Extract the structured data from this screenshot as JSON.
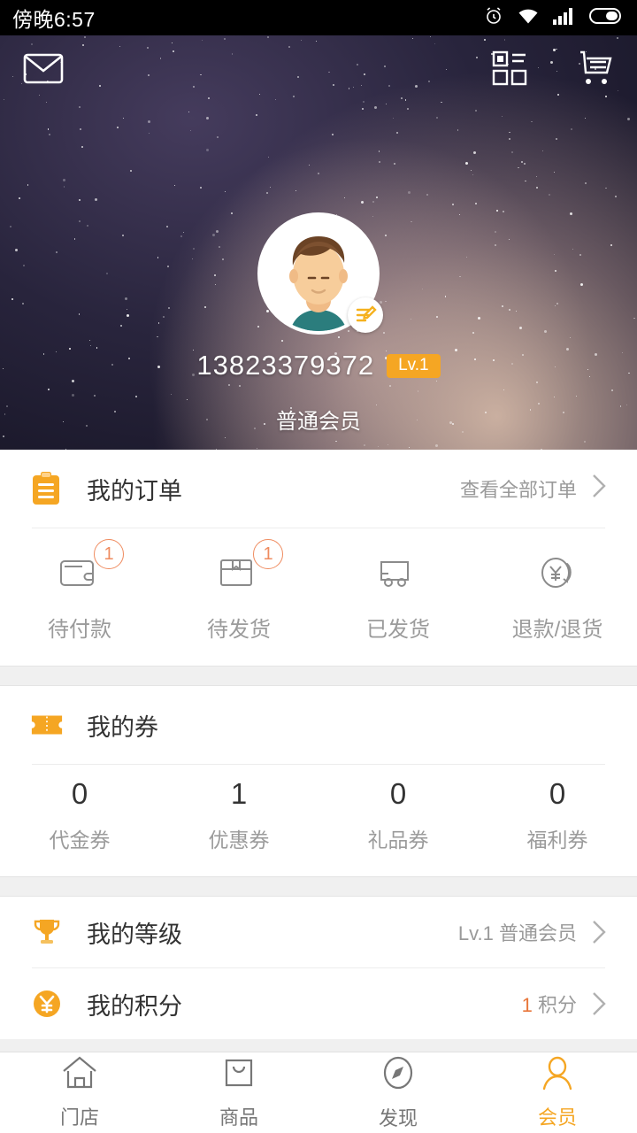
{
  "status_bar": {
    "time": "傍晚6:57",
    "icons": [
      "alarm-icon",
      "wifi-icon",
      "signal-icon",
      "battery-icon"
    ]
  },
  "header": {
    "mail_icon": "mail-icon",
    "category_icon": "category-grid-icon",
    "cart_icon": "shopping-cart-icon"
  },
  "profile": {
    "avatar": "user-avatar",
    "edit_icon": "edit-pencil-icon",
    "phone": "13823379372",
    "level_badge": "Lv.1",
    "member_type": "普通会员"
  },
  "orders": {
    "icon": "clipboard-icon",
    "title": "我的订单",
    "view_all": "查看全部订单",
    "chevron": "chevron-right-icon",
    "items": [
      {
        "icon": "wallet-icon",
        "label": "待付款",
        "badge": "1"
      },
      {
        "icon": "package-icon",
        "label": "待发货",
        "badge": "1"
      },
      {
        "icon": "truck-icon",
        "label": "已发货",
        "badge": ""
      },
      {
        "icon": "refund-icon",
        "label": "退款/退货",
        "badge": ""
      }
    ]
  },
  "coupons": {
    "icon": "ticket-icon",
    "title": "我的券",
    "items": [
      {
        "count": "0",
        "label": "代金券"
      },
      {
        "count": "1",
        "label": "优惠券"
      },
      {
        "count": "0",
        "label": "礼品券"
      },
      {
        "count": "0",
        "label": "福利券"
      }
    ]
  },
  "rows": [
    {
      "icon": "trophy-icon",
      "title": "我的等级",
      "value": "Lv.1 普通会员",
      "value_hl": "",
      "chevron": "chevron-right-icon"
    },
    {
      "icon": "yen-coin-icon",
      "title": "我的积分",
      "value": " 积分",
      "value_hl": "1",
      "chevron": "chevron-right-icon"
    }
  ],
  "tabbar": {
    "items": [
      {
        "icon": "home-icon",
        "label": "门店",
        "active": false
      },
      {
        "icon": "bag-icon",
        "label": "商品",
        "active": false
      },
      {
        "icon": "compass-icon",
        "label": "发现",
        "active": false
      },
      {
        "icon": "person-icon",
        "label": "会员",
        "active": true
      }
    ]
  },
  "colors": {
    "accent": "#f5a623",
    "badge_outline": "#ef8b5f",
    "text_primary": "#333333",
    "text_muted": "#9b9b9b"
  }
}
